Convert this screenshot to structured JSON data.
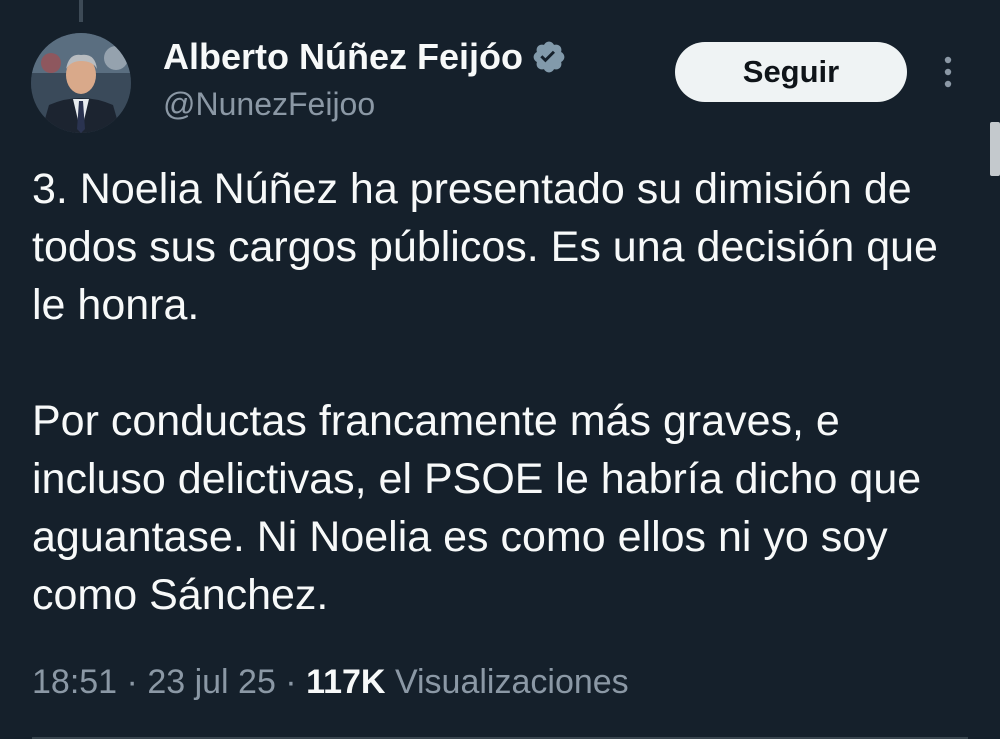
{
  "author": {
    "name": "Alberto Núñez Feijóo",
    "handle": "@NunezFeijoo",
    "verified_icon": "verified-badge-icon",
    "avatar_icon": "profile-photo"
  },
  "actions": {
    "follow_label": "Seguir",
    "more_icon": "more-options-icon"
  },
  "tweet": {
    "paragraphs": [
      "3. Noelia Núñez ha presentado su dimisión de todos sus cargos públicos. Es una decisión que le honra.",
      "Por conductas francamente más graves, e incluso delictivas, el PSOE le habría dicho que aguantase. Ni Noelia es como ellos ni yo soy como Sánchez."
    ]
  },
  "meta": {
    "time": "18:51",
    "separator": " · ",
    "date": "23 jul 25",
    "views_count": "117K",
    "views_label": "Visualizaciones"
  },
  "colors": {
    "background": "#15202b",
    "text_primary": "#f7f9f9",
    "text_secondary": "#8b98a5",
    "button_bg": "#eff3f4",
    "button_text": "#0f1419"
  }
}
